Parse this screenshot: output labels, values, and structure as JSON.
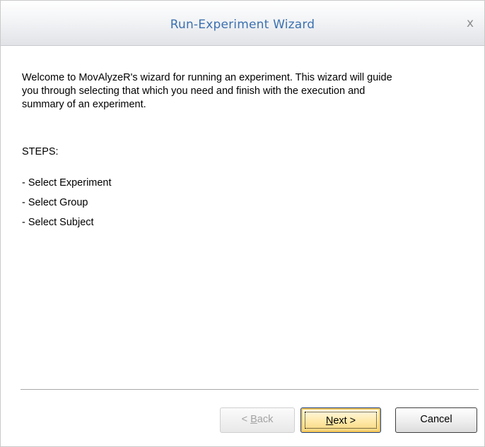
{
  "window": {
    "title": "Run-Experiment Wizard",
    "close_glyph": "x"
  },
  "content": {
    "intro": "Welcome to MovAlyzeR's wizard for running an experiment. This wizard will guide you through selecting that which you need and finish with the execution and summary of an experiment.",
    "steps_heading": "STEPS:",
    "steps": [
      "- Select Experiment",
      "- Select Group",
      "- Select Subject"
    ]
  },
  "buttons": {
    "back": {
      "prefix": "< ",
      "mnemonic": "B",
      "rest": "ack",
      "enabled": false
    },
    "next": {
      "mnemonic": "N",
      "rest": "ext >",
      "focused": true
    },
    "cancel": {
      "label": "Cancel"
    }
  },
  "colors": {
    "title_text": "#3b71b0",
    "focused_button": "#ffe9a8"
  }
}
